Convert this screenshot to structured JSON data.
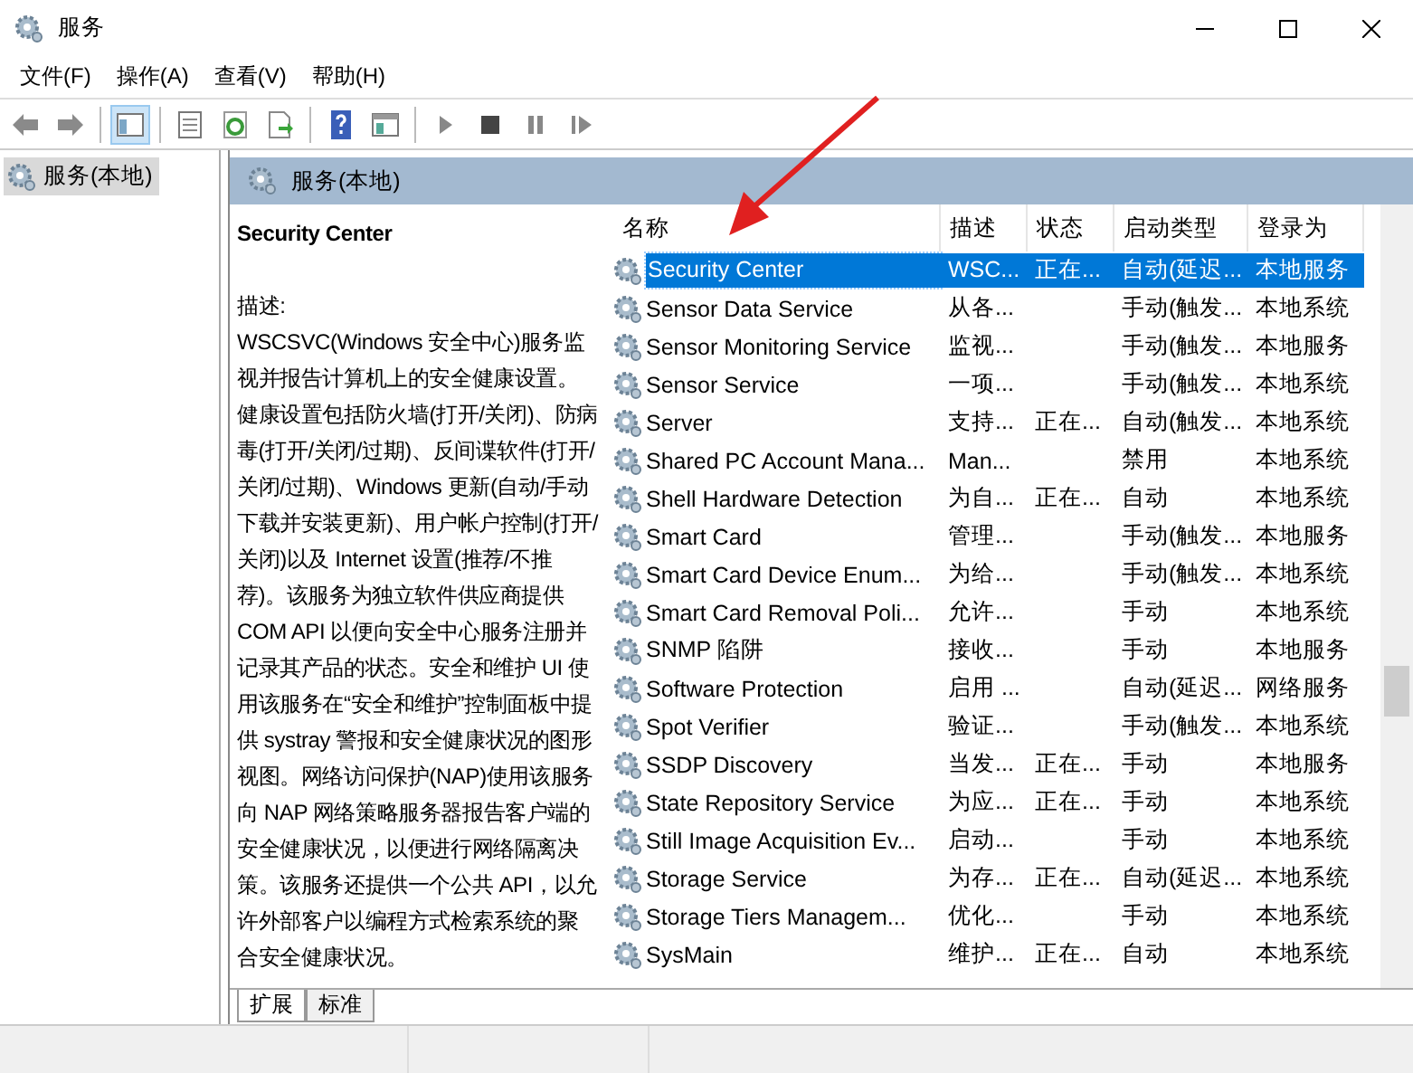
{
  "window": {
    "title": "服务"
  },
  "menu": [
    "文件(F)",
    "操作(A)",
    "查看(V)",
    "帮助(H)"
  ],
  "toolbar": [
    {
      "items": [
        {
          "kind": "back",
          "pressed": false
        },
        {
          "kind": "forward",
          "pressed": false
        }
      ]
    },
    {
      "items": [
        {
          "kind": "tree",
          "pressed": true
        }
      ]
    },
    {
      "items": [
        {
          "kind": "props",
          "pressed": false
        },
        {
          "kind": "refresh",
          "pressed": false
        },
        {
          "kind": "export",
          "pressed": false
        }
      ]
    },
    {
      "items": [
        {
          "kind": "help",
          "pressed": false
        },
        {
          "kind": "panel",
          "pressed": false
        }
      ]
    },
    {
      "items": [
        {
          "kind": "play",
          "pressed": false
        },
        {
          "kind": "stop",
          "pressed": false
        },
        {
          "kind": "pause",
          "pressed": false
        },
        {
          "kind": "resume",
          "pressed": false
        }
      ]
    }
  ],
  "tree": [
    {
      "label": "服务(本地)",
      "selected": true
    }
  ],
  "pane": {
    "title": "服务(本地)"
  },
  "details": {
    "name": "Security Center",
    "label": "描述:",
    "text": "WSCSVC(Windows 安全中心)服务监视并报告计算机上的安全健康设置。健康设置包括防火墙(打开/关闭)、防病毒(打开/关闭/过期)、反间谍软件(打开/关闭/过期)、Windows 更新(自动/手动下载并安装更新)、用户帐户控制(打开/关闭)以及 Internet 设置(推荐/不推荐)。该服务为独立软件供应商提供 COM API 以便向安全中心服务注册并记录其产品的状态。安全和维护 UI 使用该服务在“安全和维护”控制面板中提供 systray 警报和安全健康状况的图形视图。网络访问保护(NAP)使用该服务向 NAP 网络策略服务器报告客户端的安全健康状况，以便进行网络隔离决策。该服务还提供一个公共 API，以允许外部客户以编程方式检索系统的聚合安全健康状况。"
  },
  "table": {
    "columns": [
      "名称",
      "描述",
      "状态",
      "启动类型",
      "登录为"
    ],
    "rows": [
      {
        "name": "Security Center",
        "description": "WSC...",
        "status": "正在...",
        "startup": "自动(延迟...",
        "logon": "本地服务",
        "selected": true
      },
      {
        "name": "Sensor Data Service",
        "description": "从各...",
        "status": "",
        "startup": "手动(触发...",
        "logon": "本地系统",
        "selected": false
      },
      {
        "name": "Sensor Monitoring Service",
        "description": "监视...",
        "status": "",
        "startup": "手动(触发...",
        "logon": "本地服务",
        "selected": false
      },
      {
        "name": "Sensor Service",
        "description": "一项...",
        "status": "",
        "startup": "手动(触发...",
        "logon": "本地系统",
        "selected": false
      },
      {
        "name": "Server",
        "description": "支持...",
        "status": "正在...",
        "startup": "自动(触发...",
        "logon": "本地系统",
        "selected": false
      },
      {
        "name": "Shared PC Account Mana...",
        "description": "Man...",
        "status": "",
        "startup": "禁用",
        "logon": "本地系统",
        "selected": false
      },
      {
        "name": "Shell Hardware Detection",
        "description": "为自...",
        "status": "正在...",
        "startup": "自动",
        "logon": "本地系统",
        "selected": false
      },
      {
        "name": "Smart Card",
        "description": "管理...",
        "status": "",
        "startup": "手动(触发...",
        "logon": "本地服务",
        "selected": false
      },
      {
        "name": "Smart Card Device Enum...",
        "description": "为给...",
        "status": "",
        "startup": "手动(触发...",
        "logon": "本地系统",
        "selected": false
      },
      {
        "name": "Smart Card Removal Poli...",
        "description": "允许...",
        "status": "",
        "startup": "手动",
        "logon": "本地系统",
        "selected": false
      },
      {
        "name": "SNMP 陷阱",
        "description": "接收...",
        "status": "",
        "startup": "手动",
        "logon": "本地服务",
        "selected": false
      },
      {
        "name": "Software Protection",
        "description": "启用 ...",
        "status": "",
        "startup": "自动(延迟...",
        "logon": "网络服务",
        "selected": false
      },
      {
        "name": "Spot Verifier",
        "description": "验证...",
        "status": "",
        "startup": "手动(触发...",
        "logon": "本地系统",
        "selected": false
      },
      {
        "name": "SSDP Discovery",
        "description": "当发...",
        "status": "正在...",
        "startup": "手动",
        "logon": "本地服务",
        "selected": false
      },
      {
        "name": "State Repository Service",
        "description": "为应...",
        "status": "正在...",
        "startup": "手动",
        "logon": "本地系统",
        "selected": false
      },
      {
        "name": "Still Image Acquisition Ev...",
        "description": "启动...",
        "status": "",
        "startup": "手动",
        "logon": "本地系统",
        "selected": false
      },
      {
        "name": "Storage Service",
        "description": "为存...",
        "status": "正在...",
        "startup": "自动(延迟...",
        "logon": "本地系统",
        "selected": false
      },
      {
        "name": "Storage Tiers Managem...",
        "description": "优化...",
        "status": "",
        "startup": "手动",
        "logon": "本地系统",
        "selected": false
      },
      {
        "name": "SysMain",
        "description": "维护...",
        "status": "正在...",
        "startup": "自动",
        "logon": "本地系统",
        "selected": false
      }
    ]
  },
  "tabs": [
    {
      "label": "扩展",
      "selected": true
    },
    {
      "label": "标准",
      "selected": false
    }
  ]
}
